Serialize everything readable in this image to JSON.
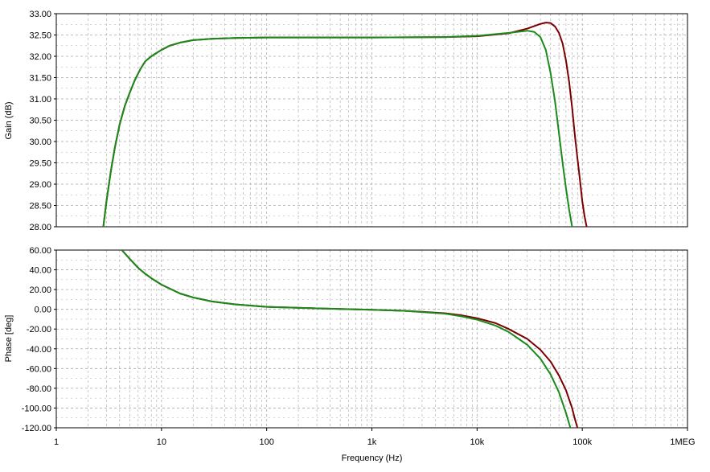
{
  "chart_data": {
    "type": "line",
    "xlabel": "Frequency (Hz)",
    "x_scale": "log",
    "x_ticks": [
      {
        "value": 1,
        "label": "1"
      },
      {
        "value": 10,
        "label": "10"
      },
      {
        "value": 100,
        "label": "100"
      },
      {
        "value": 1000,
        "label": "1k"
      },
      {
        "value": 10000,
        "label": "10k"
      },
      {
        "value": 100000,
        "label": "100k"
      },
      {
        "value": 1000000,
        "label": "1MEG"
      }
    ],
    "xlim": [
      1,
      1000000
    ],
    "grid": true,
    "colors": {
      "series_1": "#7a0000",
      "series_2": "#1a8a1a",
      "grid": "#a8a8a8"
    },
    "panels": [
      {
        "ylabel": "Gain (dB)",
        "ylim": [
          28,
          33
        ],
        "yticks": [
          "28.00",
          "28.50",
          "29.00",
          "29.50",
          "30.00",
          "30.50",
          "31.00",
          "31.50",
          "32.00",
          "32.50",
          "33.00"
        ],
        "ytick_values": [
          28,
          28.5,
          29,
          29.5,
          30,
          30.5,
          31,
          31.5,
          32,
          32.5,
          33
        ],
        "series": [
          {
            "color": "series_1",
            "points": [
              [
                2.8,
                28.0
              ],
              [
                3.0,
                28.6
              ],
              [
                3.3,
                29.3
              ],
              [
                3.6,
                29.85
              ],
              [
                4.0,
                30.4
              ],
              [
                4.5,
                30.85
              ],
              [
                5.0,
                31.15
              ],
              [
                5.6,
                31.45
              ],
              [
                6.3,
                31.7
              ],
              [
                7.0,
                31.88
              ],
              [
                8.0,
                32.0
              ],
              [
                9.0,
                32.08
              ],
              [
                10,
                32.15
              ],
              [
                12,
                32.25
              ],
              [
                15,
                32.32
              ],
              [
                20,
                32.38
              ],
              [
                30,
                32.41
              ],
              [
                50,
                32.43
              ],
              [
                100,
                32.44
              ],
              [
                1000,
                32.44
              ],
              [
                5000,
                32.45
              ],
              [
                10000,
                32.47
              ],
              [
                20000,
                32.54
              ],
              [
                30000,
                32.65
              ],
              [
                40000,
                32.76
              ],
              [
                45000,
                32.79
              ],
              [
                50000,
                32.78
              ],
              [
                55000,
                32.7
              ],
              [
                60000,
                32.55
              ],
              [
                65000,
                32.3
              ],
              [
                70000,
                31.9
              ],
              [
                75000,
                31.4
              ],
              [
                80000,
                30.8
              ],
              [
                85000,
                30.15
              ],
              [
                90000,
                29.6
              ],
              [
                95000,
                29.1
              ],
              [
                100000,
                28.6
              ],
              [
                105000,
                28.25
              ],
              [
                110000,
                28.0
              ]
            ]
          },
          {
            "color": "series_2",
            "points": [
              [
                2.8,
                28.0
              ],
              [
                3.0,
                28.6
              ],
              [
                3.3,
                29.3
              ],
              [
                3.6,
                29.85
              ],
              [
                4.0,
                30.4
              ],
              [
                4.5,
                30.85
              ],
              [
                5.0,
                31.15
              ],
              [
                5.6,
                31.45
              ],
              [
                6.3,
                31.7
              ],
              [
                7.0,
                31.88
              ],
              [
                8.0,
                32.0
              ],
              [
                9.0,
                32.08
              ],
              [
                10,
                32.15
              ],
              [
                12,
                32.25
              ],
              [
                15,
                32.32
              ],
              [
                20,
                32.38
              ],
              [
                30,
                32.41
              ],
              [
                50,
                32.43
              ],
              [
                100,
                32.44
              ],
              [
                1000,
                32.44
              ],
              [
                5000,
                32.45
              ],
              [
                10000,
                32.48
              ],
              [
                20000,
                32.55
              ],
              [
                30000,
                32.6
              ],
              [
                35000,
                32.57
              ],
              [
                40000,
                32.45
              ],
              [
                45000,
                32.15
              ],
              [
                50000,
                31.6
              ],
              [
                55000,
                30.95
              ],
              [
                60000,
                30.2
              ],
              [
                65000,
                29.5
              ],
              [
                70000,
                28.9
              ],
              [
                75000,
                28.4
              ],
              [
                80000,
                28.0
              ]
            ]
          }
        ]
      },
      {
        "ylabel": "Phase [deg]",
        "ylim": [
          -120,
          60
        ],
        "yticks": [
          "-120.00",
          "-100.00",
          "-80.00",
          "-60.00",
          "-40.00",
          "-20.00",
          "0.00",
          "20.00",
          "40.00",
          "60.00"
        ],
        "ytick_values": [
          -120,
          -100,
          -80,
          -60,
          -40,
          -20,
          0,
          20,
          40,
          60
        ],
        "series": [
          {
            "color": "series_1",
            "points": [
              [
                4.2,
                60
              ],
              [
                5,
                51
              ],
              [
                6,
                42
              ],
              [
                7,
                36
              ],
              [
                8,
                31.5
              ],
              [
                10,
                25
              ],
              [
                15,
                16
              ],
              [
                20,
                12
              ],
              [
                30,
                8
              ],
              [
                50,
                5
              ],
              [
                100,
                2.5
              ],
              [
                300,
                1
              ],
              [
                1000,
                -0.5
              ],
              [
                2000,
                -1.5
              ],
              [
                3000,
                -2.5
              ],
              [
                5000,
                -4
              ],
              [
                7000,
                -6
              ],
              [
                10000,
                -9
              ],
              [
                15000,
                -14
              ],
              [
                20000,
                -20
              ],
              [
                30000,
                -30
              ],
              [
                40000,
                -41
              ],
              [
                50000,
                -53
              ],
              [
                60000,
                -67
              ],
              [
                70000,
                -82
              ],
              [
                80000,
                -100
              ],
              [
                85000,
                -111
              ],
              [
                90000,
                -120
              ]
            ]
          },
          {
            "color": "series_2",
            "points": [
              [
                4.2,
                60
              ],
              [
                5,
                51
              ],
              [
                6,
                42
              ],
              [
                7,
                36
              ],
              [
                8,
                31.5
              ],
              [
                10,
                25
              ],
              [
                15,
                16
              ],
              [
                20,
                12
              ],
              [
                30,
                8
              ],
              [
                50,
                5
              ],
              [
                100,
                2.5
              ],
              [
                300,
                1
              ],
              [
                1000,
                -0.5
              ],
              [
                2000,
                -1.5
              ],
              [
                3000,
                -2.8
              ],
              [
                5000,
                -4.5
              ],
              [
                7000,
                -7
              ],
              [
                10000,
                -10.5
              ],
              [
                15000,
                -16.5
              ],
              [
                20000,
                -23
              ],
              [
                30000,
                -36
              ],
              [
                40000,
                -50
              ],
              [
                50000,
                -66
              ],
              [
                60000,
                -84
              ],
              [
                70000,
                -105
              ],
              [
                77000,
                -120
              ]
            ]
          }
        ]
      }
    ]
  }
}
